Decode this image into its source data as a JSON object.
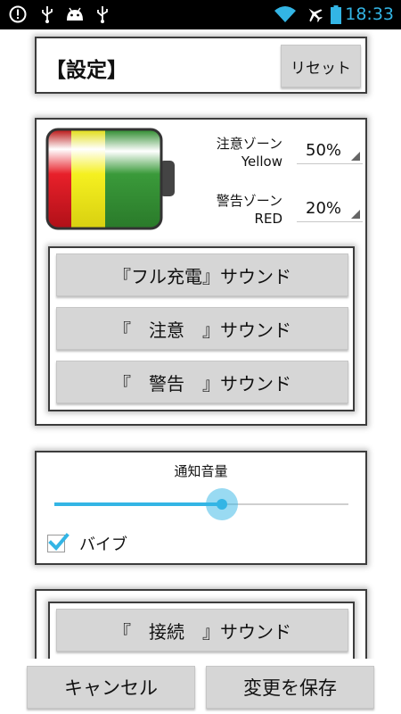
{
  "status_bar": {
    "time": "18:33",
    "left_icons": [
      "info-icon",
      "usb-icon",
      "android-icon",
      "usb-icon"
    ],
    "right_icons": [
      "wifi-icon",
      "airplane-icon",
      "battery-icon"
    ]
  },
  "header": {
    "title": "【設定】",
    "reset_label": "リセット"
  },
  "battery_card": {
    "caution_zone": {
      "label_line1": "注意ゾーン",
      "label_line2": "Yellow",
      "value": "50%"
    },
    "warning_zone": {
      "label_line1": "警告ゾーン",
      "label_line2": "RED",
      "value": "20%"
    },
    "sound_buttons": [
      "『フル充電』サウンド",
      "『　注意　』サウンド",
      "『　警告　』サウンド"
    ]
  },
  "volume_card": {
    "title": "通知音量",
    "volume_level": 0.57,
    "vibrate_label": "バイブ",
    "vibrate_checked": true
  },
  "connection_card": {
    "sound_button": "『　接続　』サウンド"
  },
  "footer": {
    "cancel_label": "キャンセル",
    "save_label": "変更を保存"
  },
  "colors": {
    "accent": "#33b5e5",
    "zone_red": "#e8202a",
    "zone_yellow": "#f5f020",
    "zone_green": "#3a9a3a"
  }
}
